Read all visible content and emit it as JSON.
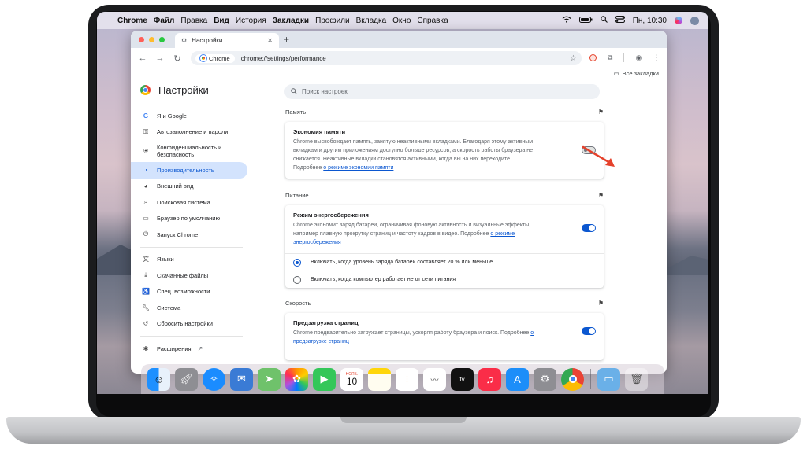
{
  "menubar": {
    "app": "Chrome",
    "items": [
      "Файл",
      "Правка",
      "Вид",
      "История",
      "Закладки",
      "Профили",
      "Вкладка",
      "Окно",
      "Справка"
    ],
    "clock": "Пн, 10:30"
  },
  "browser": {
    "tab_title": "Настройки",
    "chip_label": "Chrome",
    "url": "chrome://settings/performance",
    "bookmarks_label": "Все закладки"
  },
  "settings": {
    "title": "Настройки",
    "search_placeholder": "Поиск настроек",
    "sidebar": [
      {
        "label": "Я и Google",
        "icon": "google-icon"
      },
      {
        "label": "Автозаполнение и пароли",
        "icon": "key-icon"
      },
      {
        "label": "Конфиденциальность и безопасность",
        "icon": "shield-icon"
      },
      {
        "label": "Производительность",
        "icon": "speedometer-icon",
        "active": true
      },
      {
        "label": "Внешний вид",
        "icon": "palette-icon"
      },
      {
        "label": "Поисковая система",
        "icon": "search-icon"
      },
      {
        "label": "Браузер по умолчанию",
        "icon": "browser-icon"
      },
      {
        "label": "Запуск Chrome",
        "icon": "power-icon"
      },
      {
        "label": "Языки",
        "icon": "translate-icon"
      },
      {
        "label": "Скачанные файлы",
        "icon": "download-icon"
      },
      {
        "label": "Спец. возможности",
        "icon": "accessibility-icon"
      },
      {
        "label": "Система",
        "icon": "wrench-icon"
      },
      {
        "label": "Сбросить настройки",
        "icon": "reset-icon"
      },
      {
        "label": "Расширения",
        "icon": "puzzle-icon"
      }
    ],
    "memory": {
      "section": "Память",
      "title": "Экономия памяти",
      "text": "Chrome высвобождает память, занятую неактивными вкладками. Благодаря этому активным вкладкам и другим приложениям доступно больше ресурсов, а скорость работы браузера не снижается. Неактивные вкладки становятся активными, когда вы на них переходите.",
      "more_prefix": "Подробнее",
      "more_link": "о режиме экономии памяти",
      "enabled": false
    },
    "power": {
      "section": "Питание",
      "title": "Режим энергосбережения",
      "text": "Chrome экономит заряд батареи, ограничивая фоновую активность и визуальные эффекты, например плавную прокрутку страниц и частоту кадров в видео. Подробнее",
      "more_link": "о режиме энергосбережения",
      "enabled": true,
      "option1": "Включать, когда уровень заряда батареи составляет 20 % или меньше",
      "option2": "Включать, когда компьютер работает не от сети питания"
    },
    "speed": {
      "section": "Скорость",
      "title": "Предзагрузка страниц",
      "text": "Chrome предварительно загружает страницы, ускоряя работу браузера и поиск. Подробнее",
      "more_link": "о предзагрузке страниц",
      "enabled": true
    }
  },
  "dock": {
    "calendar_month": "НОЯБ.",
    "calendar_day": "10",
    "apps": [
      "finder-icon",
      "launchpad-icon",
      "safari-icon",
      "mail-icon",
      "maps-icon",
      "photos-icon",
      "facetime-icon",
      "calendar-icon",
      "notes-icon",
      "reminders-icon",
      "freeform-icon",
      "tv-icon",
      "music-icon",
      "app-store-icon",
      "system-settings-icon",
      "chrome-icon",
      "downloads-icon",
      "trash-icon"
    ]
  },
  "colors": {
    "accent": "#0b57d0",
    "active_nav_bg": "#d3e3fd",
    "arrow": "#e5412b"
  }
}
